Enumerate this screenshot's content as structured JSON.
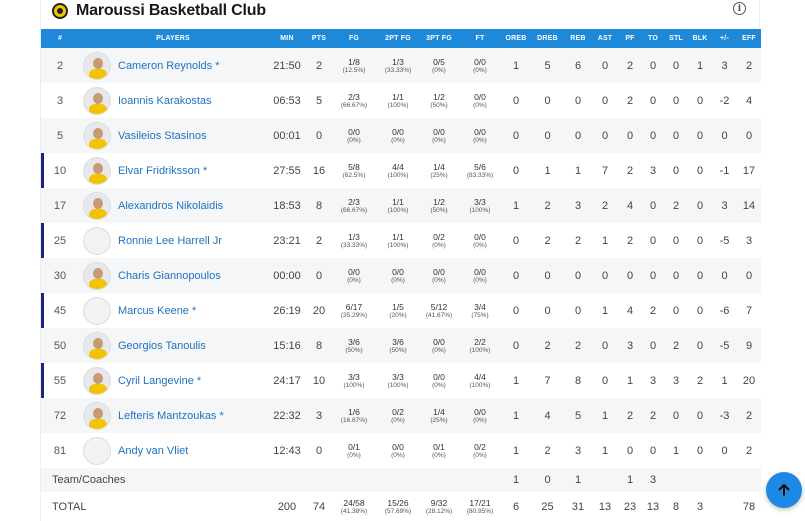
{
  "team": {
    "name": "Maroussi Basketball Club",
    "colors": {
      "accent": "#1e88d9",
      "starter_marker": "#1a237e",
      "link": "#1e73be"
    }
  },
  "columns": [
    "#",
    "PLAYERS",
    "MIN",
    "PTS",
    "FG",
    "2PT FG",
    "3PT FG",
    "FT",
    "OREB",
    "DREB",
    "REB",
    "AST",
    "PF",
    "TO",
    "STL",
    "BLK",
    "+/-",
    "EFF"
  ],
  "players": [
    {
      "num": "2",
      "name": "Cameron Reynolds *",
      "starter": false,
      "photo": true,
      "min": "21:50",
      "pts": "2",
      "fg": "1/8",
      "fg_pct": "(12.5%)",
      "fg2": "1/3",
      "fg2_pct": "(33.33%)",
      "fg3": "0/5",
      "fg3_pct": "(0%)",
      "ft": "0/0",
      "ft_pct": "(0%)",
      "oreb": "1",
      "dreb": "5",
      "reb": "6",
      "ast": "0",
      "pf": "2",
      "to": "0",
      "stl": "0",
      "blk": "1",
      "pm": "3",
      "eff": "2"
    },
    {
      "num": "3",
      "name": "Ioannis Karakostas",
      "starter": false,
      "photo": true,
      "min": "06:53",
      "pts": "5",
      "fg": "2/3",
      "fg_pct": "(66.67%)",
      "fg2": "1/1",
      "fg2_pct": "(100%)",
      "fg3": "1/2",
      "fg3_pct": "(50%)",
      "ft": "0/0",
      "ft_pct": "(0%)",
      "oreb": "0",
      "dreb": "0",
      "reb": "0",
      "ast": "0",
      "pf": "2",
      "to": "0",
      "stl": "0",
      "blk": "0",
      "pm": "-2",
      "eff": "4"
    },
    {
      "num": "5",
      "name": "Vasileios Stasinos",
      "starter": false,
      "photo": true,
      "min": "00:01",
      "pts": "0",
      "fg": "0/0",
      "fg_pct": "(0%)",
      "fg2": "0/0",
      "fg2_pct": "(0%)",
      "fg3": "0/0",
      "fg3_pct": "(0%)",
      "ft": "0/0",
      "ft_pct": "(0%)",
      "oreb": "0",
      "dreb": "0",
      "reb": "0",
      "ast": "0",
      "pf": "0",
      "to": "0",
      "stl": "0",
      "blk": "0",
      "pm": "0",
      "eff": "0"
    },
    {
      "num": "10",
      "name": "Elvar Fridriksson *",
      "starter": true,
      "photo": true,
      "min": "27:55",
      "pts": "16",
      "fg": "5/8",
      "fg_pct": "(62.5%)",
      "fg2": "4/4",
      "fg2_pct": "(100%)",
      "fg3": "1/4",
      "fg3_pct": "(25%)",
      "ft": "5/6",
      "ft_pct": "(83.33%)",
      "oreb": "0",
      "dreb": "1",
      "reb": "1",
      "ast": "7",
      "pf": "2",
      "to": "3",
      "stl": "0",
      "blk": "0",
      "pm": "-1",
      "eff": "17"
    },
    {
      "num": "17",
      "name": "Alexandros Nikolaidis",
      "starter": false,
      "photo": true,
      "min": "18:53",
      "pts": "8",
      "fg": "2/3",
      "fg_pct": "(66.67%)",
      "fg2": "1/1",
      "fg2_pct": "(100%)",
      "fg3": "1/2",
      "fg3_pct": "(50%)",
      "ft": "3/3",
      "ft_pct": "(100%)",
      "oreb": "1",
      "dreb": "2",
      "reb": "3",
      "ast": "2",
      "pf": "4",
      "to": "0",
      "stl": "2",
      "blk": "0",
      "pm": "3",
      "eff": "14"
    },
    {
      "num": "25",
      "name": "Ronnie Lee Harrell Jr",
      "starter": true,
      "photo": false,
      "min": "23:21",
      "pts": "2",
      "fg": "1/3",
      "fg_pct": "(33.33%)",
      "fg2": "1/1",
      "fg2_pct": "(100%)",
      "fg3": "0/2",
      "fg3_pct": "(0%)",
      "ft": "0/0",
      "ft_pct": "(0%)",
      "oreb": "0",
      "dreb": "2",
      "reb": "2",
      "ast": "1",
      "pf": "2",
      "to": "0",
      "stl": "0",
      "blk": "0",
      "pm": "-5",
      "eff": "3"
    },
    {
      "num": "30",
      "name": "Charis Giannopoulos",
      "starter": false,
      "photo": true,
      "min": "00:00",
      "pts": "0",
      "fg": "0/0",
      "fg_pct": "(0%)",
      "fg2": "0/0",
      "fg2_pct": "(0%)",
      "fg3": "0/0",
      "fg3_pct": "(0%)",
      "ft": "0/0",
      "ft_pct": "(0%)",
      "oreb": "0",
      "dreb": "0",
      "reb": "0",
      "ast": "0",
      "pf": "0",
      "to": "0",
      "stl": "0",
      "blk": "0",
      "pm": "0",
      "eff": "0"
    },
    {
      "num": "45",
      "name": "Marcus Keene *",
      "starter": true,
      "photo": false,
      "min": "26:19",
      "pts": "20",
      "fg": "6/17",
      "fg_pct": "(35.29%)",
      "fg2": "1/5",
      "fg2_pct": "(20%)",
      "fg3": "5/12",
      "fg3_pct": "(41.67%)",
      "ft": "3/4",
      "ft_pct": "(75%)",
      "oreb": "0",
      "dreb": "0",
      "reb": "0",
      "ast": "1",
      "pf": "4",
      "to": "2",
      "stl": "0",
      "blk": "0",
      "pm": "-6",
      "eff": "7"
    },
    {
      "num": "50",
      "name": "Georgios Tanoulis",
      "starter": false,
      "photo": true,
      "min": "15:16",
      "pts": "8",
      "fg": "3/6",
      "fg_pct": "(50%)",
      "fg2": "3/6",
      "fg2_pct": "(50%)",
      "fg3": "0/0",
      "fg3_pct": "(0%)",
      "ft": "2/2",
      "ft_pct": "(100%)",
      "oreb": "0",
      "dreb": "2",
      "reb": "2",
      "ast": "0",
      "pf": "3",
      "to": "0",
      "stl": "2",
      "blk": "0",
      "pm": "-5",
      "eff": "9"
    },
    {
      "num": "55",
      "name": "Cyril Langevine *",
      "starter": true,
      "photo": true,
      "min": "24:17",
      "pts": "10",
      "fg": "3/3",
      "fg_pct": "(100%)",
      "fg2": "3/3",
      "fg2_pct": "(100%)",
      "fg3": "0/0",
      "fg3_pct": "(0%)",
      "ft": "4/4",
      "ft_pct": "(100%)",
      "oreb": "1",
      "dreb": "7",
      "reb": "8",
      "ast": "0",
      "pf": "1",
      "to": "3",
      "stl": "3",
      "blk": "2",
      "pm": "1",
      "eff": "20"
    },
    {
      "num": "72",
      "name": "Lefteris Mantzoukas *",
      "starter": false,
      "photo": true,
      "min": "22:32",
      "pts": "3",
      "fg": "1/6",
      "fg_pct": "(16.67%)",
      "fg2": "0/2",
      "fg2_pct": "(0%)",
      "fg3": "1/4",
      "fg3_pct": "(25%)",
      "ft": "0/0",
      "ft_pct": "(0%)",
      "oreb": "1",
      "dreb": "4",
      "reb": "5",
      "ast": "1",
      "pf": "2",
      "to": "2",
      "stl": "0",
      "blk": "0",
      "pm": "-3",
      "eff": "2"
    },
    {
      "num": "81",
      "name": "Andy van Vliet",
      "starter": false,
      "photo": false,
      "min": "12:43",
      "pts": "0",
      "fg": "0/1",
      "fg_pct": "(0%)",
      "fg2": "0/0",
      "fg2_pct": "(0%)",
      "fg3": "0/1",
      "fg3_pct": "(0%)",
      "ft": "0/2",
      "ft_pct": "(0%)",
      "oreb": "1",
      "dreb": "2",
      "reb": "3",
      "ast": "1",
      "pf": "0",
      "to": "0",
      "stl": "1",
      "blk": "0",
      "pm": "0",
      "eff": "2"
    }
  ],
  "team_coaches": {
    "label": "Team/Coaches",
    "oreb": "1",
    "dreb": "0",
    "reb": "1",
    "pf": "1",
    "to": "3"
  },
  "totals": {
    "label": "TOTAL",
    "min": "200",
    "pts": "74",
    "fg": "24/58",
    "fg_pct": "(41.38%)",
    "fg2": "15/26",
    "fg2_pct": "(57.69%)",
    "fg3": "9/32",
    "fg3_pct": "(28.12%)",
    "ft": "17/21",
    "ft_pct": "(80.95%)",
    "oreb": "6",
    "dreb": "25",
    "reb": "31",
    "ast": "13",
    "pf": "23",
    "to": "13",
    "stl": "8",
    "blk": "3",
    "pm": "",
    "eff": "78"
  },
  "icons": {
    "info": "info-icon",
    "scroll_top": "arrow-up-icon",
    "logo": "team-logo-icon"
  }
}
